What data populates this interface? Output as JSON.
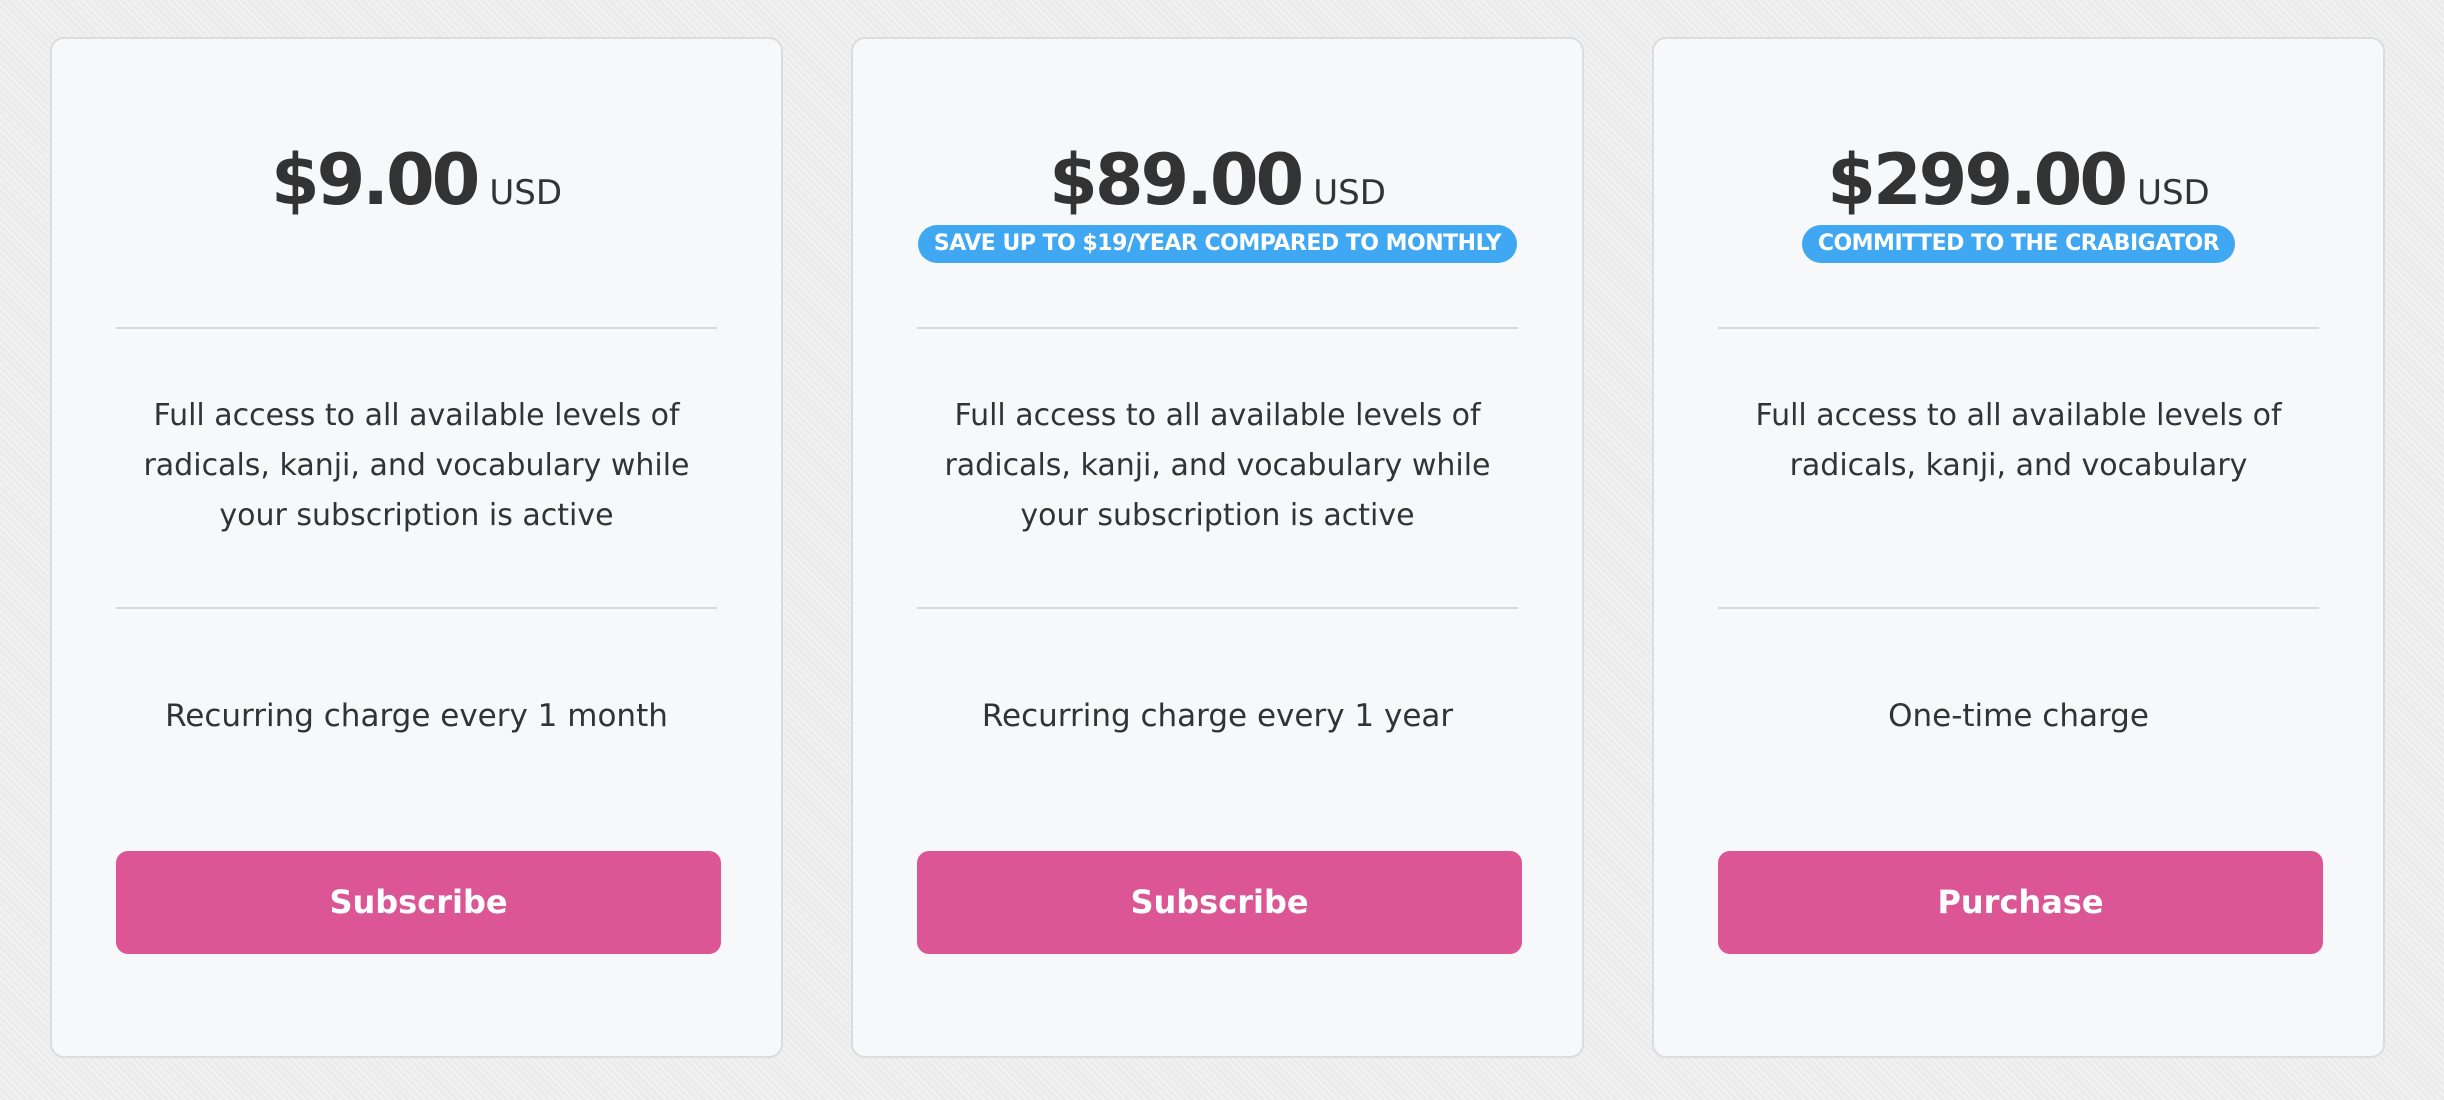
{
  "plans": [
    {
      "price": "$9.00",
      "currency": "USD",
      "badge": "",
      "description": "Full access to all available levels of radicals, kanji, and vocabulary while your subscription is active",
      "charge": "Recurring charge every 1 month",
      "button_label": "Subscribe"
    },
    {
      "price": "$89.00",
      "currency": "USD",
      "badge": "SAVE UP TO $19/YEAR COMPARED TO MONTHLY",
      "description": "Full access to all available levels of radicals, kanji, and vocabulary while your subscription is active",
      "charge": "Recurring charge every 1 year",
      "button_label": "Subscribe"
    },
    {
      "price": "$299.00",
      "currency": "USD",
      "badge": "COMMITTED TO THE CRABIGATOR",
      "description": "Full access to all available levels of radicals, kanji, and vocabulary",
      "charge": "One-time charge",
      "button_label": "Purchase"
    }
  ],
  "colors": {
    "page_background": "#ebebeb",
    "card_background": "#f7f8fa",
    "card_border": "#dcdcdc",
    "badge": "#40a7f2",
    "button": "#dc5695",
    "text": "#333333"
  }
}
